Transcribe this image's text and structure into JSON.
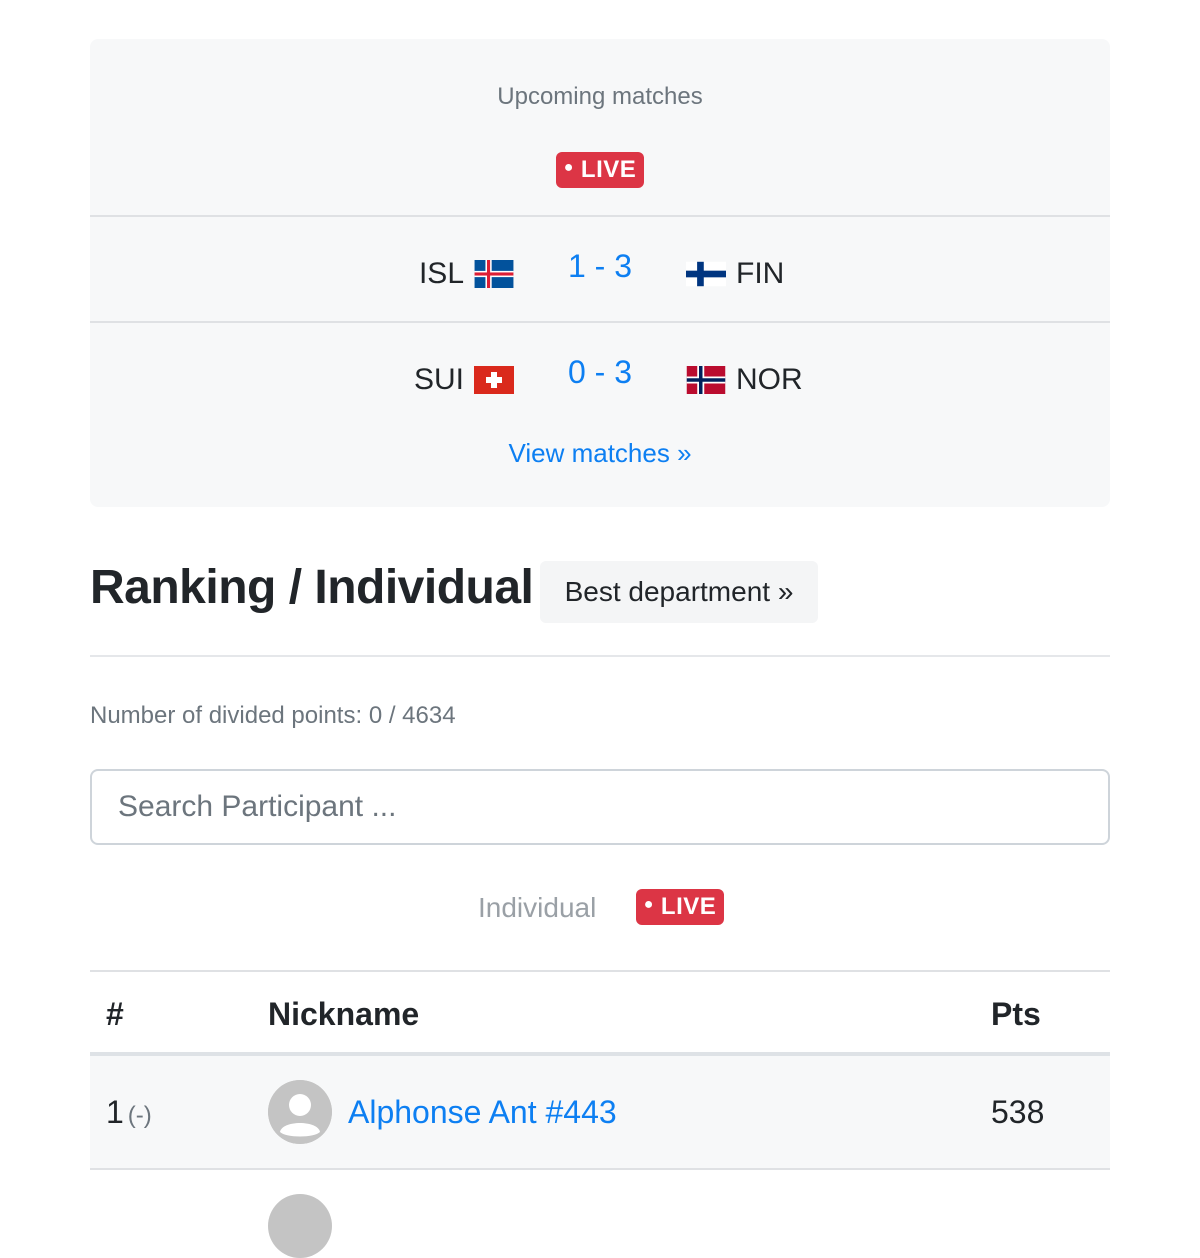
{
  "matches": {
    "title": "Upcoming matches",
    "live_label": "LIVE",
    "items": [
      {
        "home": "ISL",
        "home_flag": "iceland-flag-icon",
        "score": "1 - 3",
        "away": "FIN",
        "away_flag": "finland-flag-icon"
      },
      {
        "home": "SUI",
        "home_flag": "switzerland-flag-icon",
        "score": "0 - 3",
        "away": "NOR",
        "away_flag": "norway-flag-icon"
      }
    ],
    "view_link": "View matches »"
  },
  "ranking": {
    "title": "Ranking / Individual",
    "best_department": "Best department »",
    "divided_points": "Number of divided points: 0 / 4634",
    "search_placeholder": "Search Participant ...",
    "tab_label": "Individual",
    "live_label": "LIVE"
  },
  "table": {
    "columns": [
      "#",
      "Nickname",
      "Pts"
    ],
    "rows": [
      {
        "rank": "1",
        "change": "(-)",
        "nickname": "Alphonse Ant #443",
        "points": "538"
      }
    ]
  },
  "colors": {
    "accent": "#0d7ff2",
    "live": "#dc3545",
    "card_bg": "#f7f8f9"
  }
}
